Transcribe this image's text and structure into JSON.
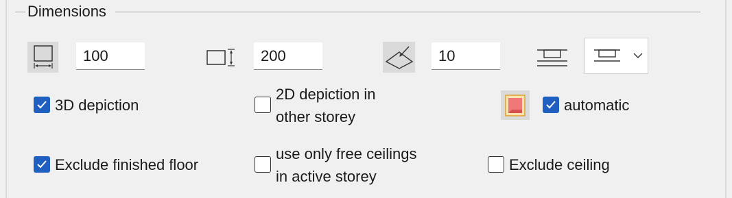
{
  "group": {
    "title": "Dimensions"
  },
  "fields": {
    "width_value": "100",
    "height_value": "200",
    "angle_value": "10"
  },
  "icons": {
    "width": "width-dimension-icon",
    "height": "height-dimension-icon",
    "angle": "slope-angle-icon",
    "ceiling": "ceiling-reference-icon",
    "color": "red-surface-swatch-icon"
  },
  "checkboxes": {
    "depiction_3d": {
      "label": "3D depiction",
      "checked": true
    },
    "depiction_2d": {
      "label_line1": "2D depiction in",
      "label_line2": "other storey",
      "checked": false
    },
    "automatic": {
      "label": "automatic",
      "checked": true
    },
    "exclude_floor": {
      "label": "Exclude finished floor",
      "checked": true
    },
    "free_ceilings": {
      "label_line1": "use only free ceilings",
      "label_line2": "in active storey",
      "checked": false
    },
    "exclude_ceiling": {
      "label": "Exclude ceiling",
      "checked": false
    }
  },
  "colors": {
    "accent": "#1f5fbf",
    "swatch_fill": "#f07878",
    "swatch_border": "#e0a030"
  }
}
